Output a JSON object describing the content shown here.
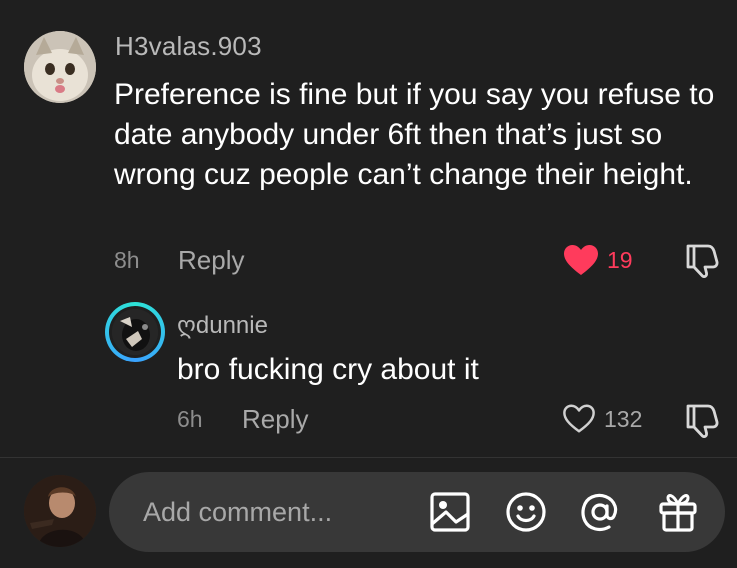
{
  "comments": [
    {
      "username": "H3valas.903",
      "text": "Preference is fine but if you say you refuse to date anybody under 6ft then that’s just so wrong cuz people can’t change their height.",
      "time": "8h",
      "reply_label": "Reply",
      "likes": "19",
      "liked": true,
      "avatar_icon": "cat-avatar"
    },
    {
      "username": "ღdunnie",
      "text": "bro fucking cry about it",
      "time": "6h",
      "reply_label": "Reply",
      "likes": "132",
      "liked": false,
      "avatar_icon": "user-avatar-with-story-ring"
    }
  ],
  "composer": {
    "placeholder": "Add comment...",
    "tools": [
      "image-icon",
      "emoji-icon",
      "mention-icon",
      "gift-icon"
    ]
  },
  "colors": {
    "background": "#1f1f1f",
    "liked_heart": "#ff3b5c",
    "secondary_text": "#a9a9a9",
    "input_bg": "#383838",
    "story_ring": "#2de3d6"
  }
}
